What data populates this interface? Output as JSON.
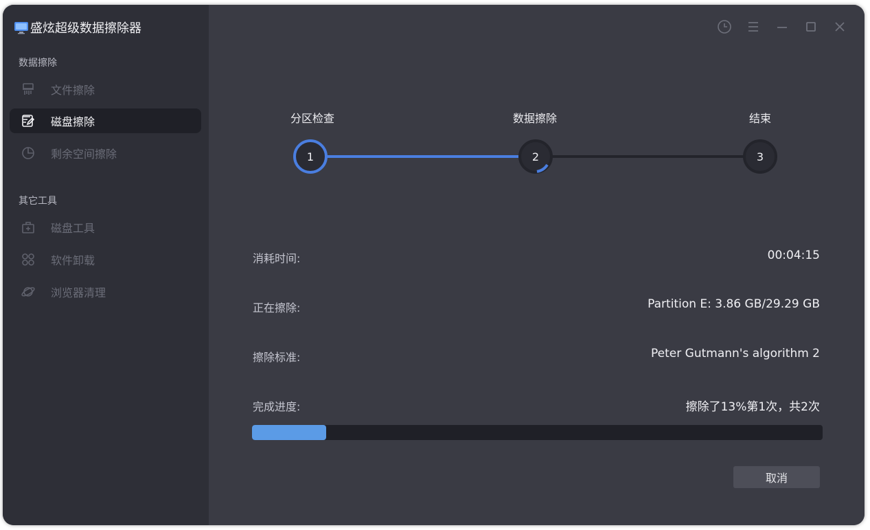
{
  "app": {
    "title": "盛炫超级数据擦除器"
  },
  "sidebar": {
    "sections": [
      {
        "label": "数据擦除",
        "items": [
          {
            "label": "文件擦除",
            "icon": "shredder-icon",
            "active": false
          },
          {
            "label": "磁盘擦除",
            "icon": "disk-edit-icon",
            "active": true
          },
          {
            "label": "剩余空间擦除",
            "icon": "pie-chart-icon",
            "active": false
          }
        ]
      },
      {
        "label": "其它工具",
        "items": [
          {
            "label": "磁盘工具",
            "icon": "toolbox-icon",
            "active": false
          },
          {
            "label": "软件卸载",
            "icon": "apps-grid-icon",
            "active": false
          },
          {
            "label": "浏览器清理",
            "icon": "browser-planet-icon",
            "active": false
          }
        ]
      }
    ]
  },
  "window_controls": [
    "history-clock-icon",
    "menu-icon",
    "minimize-icon",
    "maximize-icon",
    "close-icon"
  ],
  "stepper": {
    "steps": [
      {
        "label": "分区检查",
        "number": "1",
        "state": "completed"
      },
      {
        "label": "数据擦除",
        "number": "2",
        "state": "active"
      },
      {
        "label": "结束",
        "number": "3",
        "state": "pending"
      }
    ]
  },
  "details": {
    "elapsed_label": "消耗时间:",
    "elapsed_value": "00:04:15",
    "erasing_label": "正在擦除:",
    "erasing_value": "Partition E: 3.86 GB/29.29 GB",
    "standard_label": "擦除标准:",
    "standard_value": "Peter Gutmann's algorithm 2",
    "progress_label": "完成进度:",
    "progress_value": "擦除了13%第1次，共2次",
    "progress_percent": 13
  },
  "actions": {
    "cancel_label": "取消"
  },
  "colors": {
    "accent": "#4a7ee0",
    "progress_fill": "#5b9be6",
    "sidebar_bg": "#2e2f37",
    "main_bg": "#3a3b44"
  }
}
